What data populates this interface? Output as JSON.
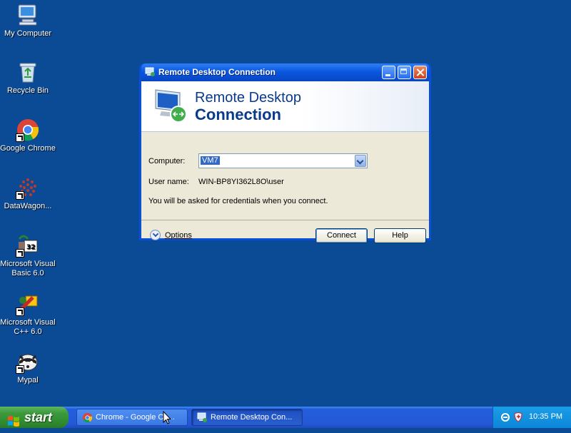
{
  "desktop": {
    "icons": [
      {
        "label": "My Computer",
        "icon": "my-computer-icon"
      },
      {
        "label": "Recycle Bin",
        "icon": "recycle-bin-icon"
      },
      {
        "label": "Google Chrome",
        "icon": "chrome-icon"
      },
      {
        "label": "DataWagon...",
        "icon": "datawagon-icon"
      },
      {
        "label": "Microsoft Visual Basic 6.0",
        "icon": "visual-basic-icon"
      },
      {
        "label": "Microsoft Visual C++ 6.0",
        "icon": "visual-cpp-icon"
      },
      {
        "label": "Mypal",
        "icon": "mypal-icon"
      }
    ]
  },
  "window": {
    "title": "Remote Desktop Connection",
    "banner_line1": "Remote Desktop",
    "banner_line2": "Connection",
    "computer_label": "Computer:",
    "computer_value": "VM7",
    "user_label": "User name:",
    "user_value": "WIN-BP8YI362L8O\\user",
    "note": "You will be asked for credentials when you connect.",
    "options_label": "Options",
    "connect_label": "Connect",
    "help_label": "Help"
  },
  "taskbar": {
    "start_label": "start",
    "tasks": [
      {
        "label": "Chrome - Google Ch...",
        "icon": "chrome-icon",
        "active": false
      },
      {
        "label": "Remote Desktop Con...",
        "icon": "remote-desktop-icon",
        "active": true
      }
    ],
    "clock": "10:35 PM"
  },
  "colors": {
    "desktop_bg": "#0b4a95",
    "titlebar": "#0b57e0",
    "dialog_bg": "#ece9d8",
    "selection": "#316ac5"
  }
}
